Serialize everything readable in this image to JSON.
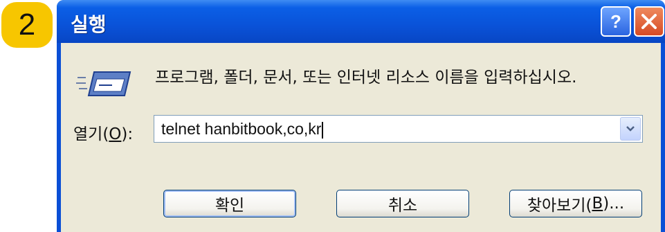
{
  "step_badge": "2",
  "window": {
    "title": "실행",
    "prompt": "프로그램, 폴더, 문서, 또는 인터넷 리소스 이름을 입력하십시오.",
    "open_label_prefix": "열기(",
    "open_label_mnemonic": "O",
    "open_label_suffix": "):",
    "command_value": "telnet hanbitbook,co,kr"
  },
  "buttons": {
    "ok": "확인",
    "cancel": "취소",
    "browse_prefix": "찾아보기(",
    "browse_mnemonic": "B",
    "browse_suffix": ")..."
  },
  "icons": {
    "run": "run-program-icon",
    "help": "help-icon",
    "close": "close-icon",
    "dropdown": "chevron-down-icon"
  },
  "colors": {
    "titlebar": "#0a52d8",
    "client_bg": "#ece9d8",
    "badge": "#f7c600",
    "close_button": "#d64a24"
  }
}
